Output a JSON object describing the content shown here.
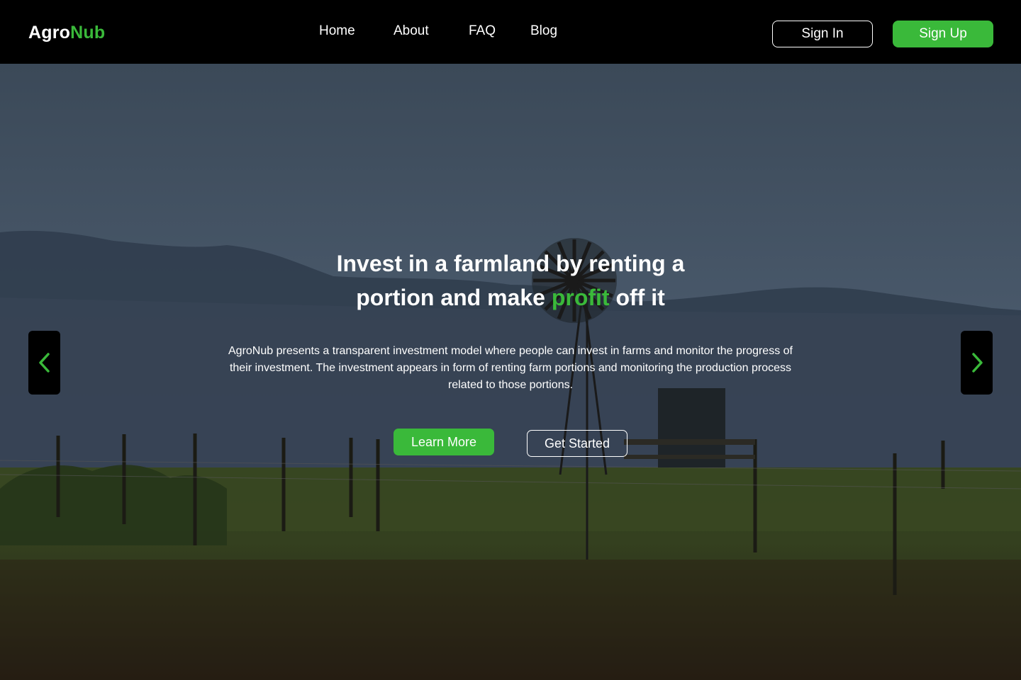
{
  "brand": {
    "part1": "Agro",
    "part2": "Nub"
  },
  "nav": {
    "links": [
      "Home",
      "About",
      "FAQ",
      "Blog"
    ],
    "signin": "Sign In",
    "signup": "Sign Up"
  },
  "hero": {
    "title_line1": "Invest in a farmland by renting  a",
    "title_line2_pre": "portion and make ",
    "title_highlight": "profit",
    "title_line2_post": " off it",
    "description": "AgroNub presents a transparent investment model where people can invest in farms and monitor the progress of their investment. The investment appears in form of renting farm portions and monitoring the production process related to those portions.",
    "learn_more": "Learn More",
    "get_started": "Get Started"
  },
  "icons": {
    "prev": "chevron-left-icon",
    "next": "chevron-right-icon"
  },
  "colors": {
    "accent": "#3ab93a",
    "navbar": "#000000",
    "text": "#ffffff"
  }
}
